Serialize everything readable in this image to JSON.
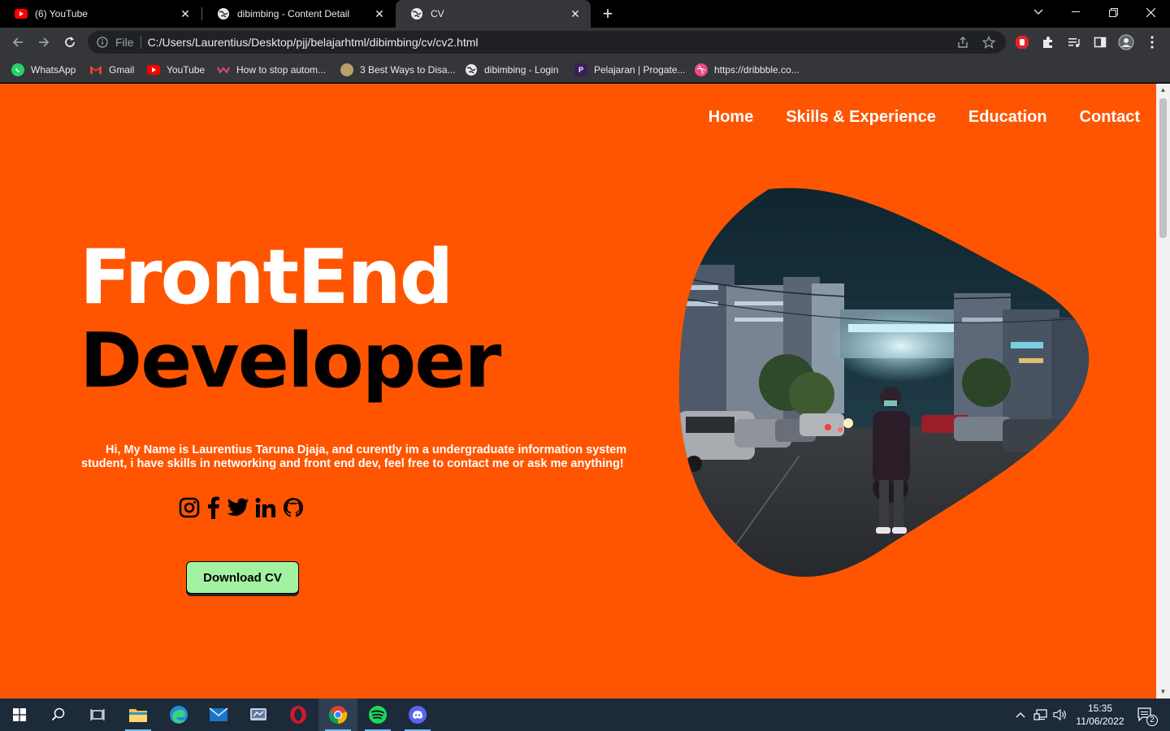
{
  "browser": {
    "tabs": [
      {
        "title": "(6) YouTube",
        "icon": "youtube-icon",
        "active": false
      },
      {
        "title": "dibimbing - Content Detail",
        "icon": "globe-icon",
        "active": false
      },
      {
        "title": "CV",
        "icon": "globe-icon",
        "active": true
      }
    ],
    "address": {
      "scheme_label": "File",
      "url": "C:/Users/Laurentius/Desktop/pjj/belajarhtml/dibimbing/cv/cv2.html"
    },
    "bookmarks": [
      {
        "label": "WhatsApp",
        "icon": "whatsapp-icon"
      },
      {
        "label": "Gmail",
        "icon": "gmail-icon"
      },
      {
        "label": "YouTube",
        "icon": "youtube-icon"
      },
      {
        "label": "How to stop autom...",
        "icon": "site-icon"
      },
      {
        "label": "3 Best Ways to Disa...",
        "icon": "site-icon"
      },
      {
        "label": "dibimbing - Login",
        "icon": "globe-icon"
      },
      {
        "label": "Pelajaran | Progate...",
        "icon": "progate-icon"
      },
      {
        "label": "https://dribbble.co...",
        "icon": "dribbble-icon"
      }
    ]
  },
  "page": {
    "nav": [
      "Home",
      "Skills & Experience",
      "Education",
      "Contact"
    ],
    "hero": {
      "title_line1": "FrontEnd",
      "title_line2": "Developer",
      "description": "Hi, My Name is Laurentius Taruna Djaja, and curently im a undergraduate information system student, i have skills in networking and front end dev, feel free to contact me or ask me anything!"
    },
    "socials": [
      "instagram-icon",
      "facebook-icon",
      "twitter-icon",
      "linkedin-icon",
      "github-icon"
    ],
    "download_label": "Download CV"
  },
  "taskbar": {
    "time": "15:35",
    "date": "11/06/2022",
    "notification_count": "2"
  },
  "colors": {
    "page_bg": "#ff5500",
    "button_bg": "#a2f2a2",
    "chrome_dark": "#35363a",
    "taskbar": "#1c2a3a"
  }
}
